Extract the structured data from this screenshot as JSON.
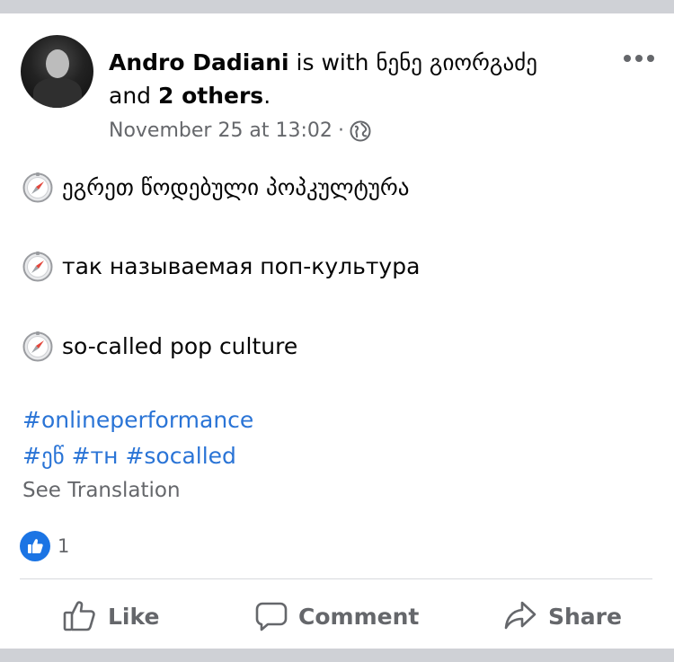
{
  "post": {
    "author": "Andro Dadiani",
    "with_text": "is with",
    "tagged_person": "ნენე გიორგაძე",
    "and_text": "and",
    "others": "2 others",
    "period": ".",
    "timestamp": "November 25 at 13:02",
    "separator": "·",
    "privacy_icon": "globe-icon",
    "lines": [
      "ეგრეთ წოდებული პოპკულტურა",
      "так называемая поп-культура",
      "so-called pop culture"
    ],
    "line_icon": "compass-icon",
    "hashtags_line1": "#onlineperformance",
    "hashtags_line2": [
      "#ეწ",
      "#тн",
      "#socalled"
    ],
    "see_translation": "See Translation",
    "reactions": {
      "icon": "like-icon",
      "count": "1"
    }
  },
  "actions": {
    "like": "Like",
    "comment": "Comment",
    "share": "Share"
  },
  "colors": {
    "link": "#2a74d6",
    "secondary_text": "#65676b",
    "like_blue": "#1b74e4",
    "background": "#cfd1d6"
  }
}
